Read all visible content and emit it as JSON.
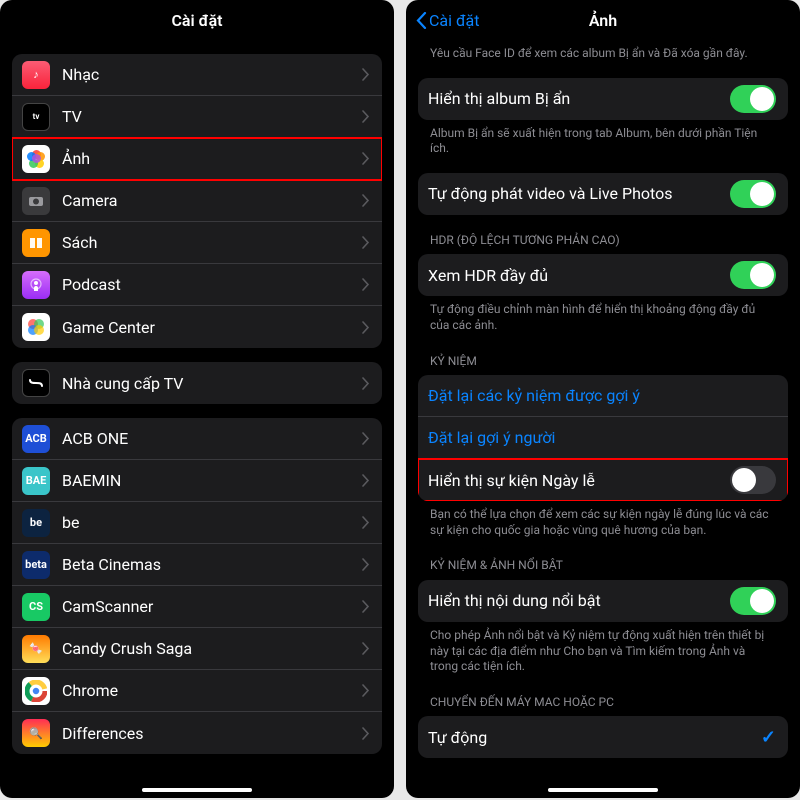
{
  "left": {
    "title": "Cài đặt",
    "group1": [
      {
        "label": "Nhạc",
        "icon": "music"
      },
      {
        "label": "TV",
        "icon": "tv"
      },
      {
        "label": "Ảnh",
        "icon": "photos",
        "highlight": true
      },
      {
        "label": "Camera",
        "icon": "camera"
      },
      {
        "label": "Sách",
        "icon": "books"
      },
      {
        "label": "Podcast",
        "icon": "podcast"
      },
      {
        "label": "Game Center",
        "icon": "gamecenter"
      }
    ],
    "group2": [
      {
        "label": "Nhà cung cấp TV",
        "icon": "tvprov"
      }
    ],
    "group3": [
      {
        "label": "ACB ONE",
        "icon": "acb",
        "txt": "ACB"
      },
      {
        "label": "BAEMIN",
        "icon": "baemin",
        "txt": "BAE"
      },
      {
        "label": "be",
        "icon": "be",
        "txt": "be"
      },
      {
        "label": "Beta Cinemas",
        "icon": "beta",
        "txt": "beta"
      },
      {
        "label": "CamScanner",
        "icon": "camscanner",
        "txt": "CS"
      },
      {
        "label": "Candy Crush Saga",
        "icon": "candy"
      },
      {
        "label": "Chrome",
        "icon": "chrome"
      },
      {
        "label": "Differences",
        "icon": "diff"
      }
    ]
  },
  "right": {
    "back": "Cài đặt",
    "title": "Ảnh",
    "faceid_caption": "Yêu cầu Face ID để xem các album Bị ẩn và Đã xóa gần đây.",
    "hidden_album_label": "Hiển thị album Bị ẩn",
    "hidden_album_caption": "Album Bị ẩn sẽ xuất hiện trong tab Album, bên dưới phần Tiện ích.",
    "autoplay_label": "Tự động phát video và Live Photos",
    "hdr_header": "HDR (ĐỘ LỆCH TƯƠNG PHẢN CAO)",
    "hdr_label": "Xem HDR đầy đủ",
    "hdr_caption": "Tự động điều chỉnh màn hình để hiển thị khoảng động đầy đủ của các ảnh.",
    "memories_header": "KỶ NIỆM",
    "reset_memories": "Đặt lại các kỷ niệm được gợi ý",
    "reset_people": "Đặt lại gợi ý người",
    "holiday_label": "Hiển thị sự kiện Ngày lễ",
    "holiday_caption": "Bạn có thể lựa chọn để xem các sự kiện ngày lễ đúng lúc và các sự kiện cho quốc gia hoặc vùng quê hương của bạn.",
    "featured_header": "KỶ NIỆM & ẢNH NỔI BẬT",
    "featured_label": "Hiển thị nội dung nổi bật",
    "featured_caption": "Cho phép Ảnh nổi bật và Kỷ niệm tự động xuất hiện trên thiết bị này tại các địa điểm như Cho bạn và Tìm kiếm trong Ảnh và trong các tiện ích.",
    "transfer_header": "CHUYỂN ĐẾN MÁY MAC HOẶC PC",
    "transfer_auto": "Tự động"
  }
}
